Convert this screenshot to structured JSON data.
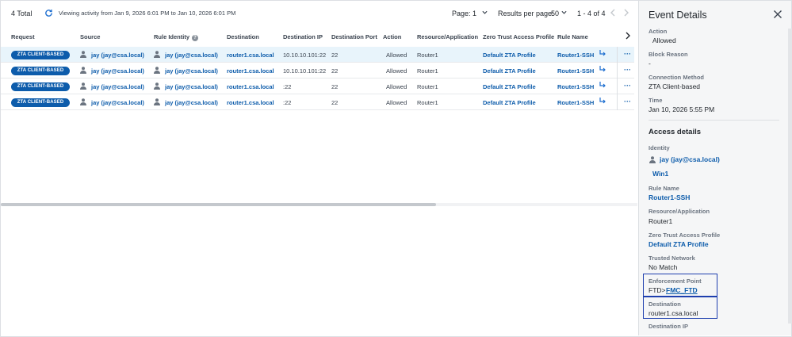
{
  "toolbar": {
    "total": "4 Total",
    "viewing": "Viewing activity from Jan 9, 2026 6:01 PM to Jan 10, 2026 6:01 PM",
    "page_label": "Page:",
    "page_value": "1",
    "rpp_label": "Results per page:",
    "rpp_value": "50",
    "range": "1 - 4 of 4"
  },
  "table": {
    "columns": [
      "Request",
      "Source",
      "Rule Identity",
      "Destination",
      "Destination IP",
      "Destination Port",
      "Action",
      "Resource/Application",
      "Zero Trust Access Profile",
      "Rule Name"
    ],
    "rows": [
      {
        "request": "ZTA CLIENT-BASED",
        "source": "jay (jay@csa.local)",
        "identity": "jay (jay@csa.local)",
        "destination": "router1.csa.local",
        "dest_ip": "10.10.10.101:22",
        "dest_port": "22",
        "action": "Allowed",
        "resource": "Router1",
        "profile": "Default ZTA Profile",
        "rule": "Router1-SSH",
        "more": "···"
      },
      {
        "request": "ZTA CLIENT-BASED",
        "source": "jay (jay@csa.local)",
        "identity": "jay (jay@csa.local)",
        "destination": "router1.csa.local",
        "dest_ip": "10.10.10.101:22",
        "dest_port": "22",
        "action": "Allowed",
        "resource": "Router1",
        "profile": "Default ZTA Profile",
        "rule": "Router1-SSH",
        "more": "···"
      },
      {
        "request": "ZTA CLIENT-BASED",
        "source": "jay (jay@csa.local)",
        "identity": "jay (jay@csa.local)",
        "destination": "router1.csa.local",
        "dest_ip": ":22",
        "dest_port": "22",
        "action": "Allowed",
        "resource": "Router1",
        "profile": "Default ZTA Profile",
        "rule": "Router1-SSH",
        "more": "···"
      },
      {
        "request": "ZTA CLIENT-BASED",
        "source": "jay (jay@csa.local)",
        "identity": "jay (jay@csa.local)",
        "destination": "router1.csa.local",
        "dest_ip": ":22",
        "dest_port": "22",
        "action": "Allowed",
        "resource": "Router1",
        "profile": "Default ZTA Profile",
        "rule": "Router1-SSH",
        "more": "···"
      }
    ]
  },
  "details": {
    "title": "Event Details",
    "action_label": "Action",
    "action_value": "Allowed",
    "block_label": "Block Reason",
    "block_value": "-",
    "conn_label": "Connection Method",
    "conn_value": "ZTA Client-based",
    "time_label": "Time",
    "time_value": "Jan 10, 2026 5:55 PM",
    "access_title": "Access details",
    "identity_label": "Identity",
    "identity_value": "jay (jay@csa.local)",
    "device_value": "Win1",
    "rule_label": "Rule Name",
    "rule_value": "Router1-SSH",
    "resource_label": "Resource/Application",
    "resource_value": "Router1",
    "profile_label": "Zero Trust Access Profile",
    "profile_value": "Default ZTA Profile",
    "trusted_label": "Trusted Network",
    "trusted_value": "No Match",
    "enforce_label": "Enforcement Point",
    "enforce_prefix": "FTD>",
    "enforce_value": "FMC_FTD",
    "dest_label": "Destination",
    "dest_value": "router1.csa.local",
    "destip_label": "Destination IP"
  },
  "colors": {
    "accent": "#0d5cab",
    "selected_row": "#e8f4fb",
    "highlight_box": "#1e3fae"
  }
}
